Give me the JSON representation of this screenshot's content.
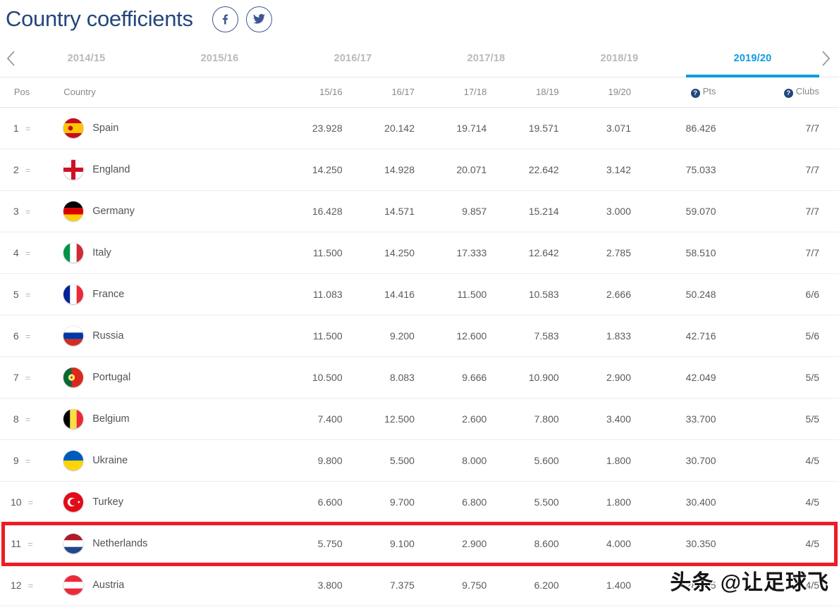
{
  "header": {
    "title": "Country coefficients",
    "social": [
      {
        "name": "facebook-share-button",
        "glyph": "f"
      },
      {
        "name": "twitter-share-button",
        "glyph": "bird"
      }
    ]
  },
  "tabs": {
    "prev_arrow": "‹",
    "next_arrow": "›",
    "items": [
      {
        "label": "2014/15",
        "active": false
      },
      {
        "label": "2015/16",
        "active": false
      },
      {
        "label": "2016/17",
        "active": false
      },
      {
        "label": "2017/18",
        "active": false
      },
      {
        "label": "2018/19",
        "active": false
      },
      {
        "label": "2019/20",
        "active": true
      }
    ],
    "active_color": "#109ae0"
  },
  "table": {
    "headers": {
      "pos": "Pos",
      "country": "Country",
      "s1516": "15/16",
      "s1617": "16/17",
      "s1718": "17/18",
      "s1819": "18/19",
      "s1920": "19/20",
      "pts": "Pts",
      "clubs": "Clubs",
      "info_glyph": "?"
    },
    "rows": [
      {
        "pos": "1",
        "move": "=",
        "flag": "spain",
        "country": "Spain",
        "s1516": "23.928",
        "s1617": "20.142",
        "s1718": "19.714",
        "s1819": "19.571",
        "s1920": "3.071",
        "pts": "86.426",
        "clubs": "7/7"
      },
      {
        "pos": "2",
        "move": "=",
        "flag": "england",
        "country": "England",
        "s1516": "14.250",
        "s1617": "14.928",
        "s1718": "20.071",
        "s1819": "22.642",
        "s1920": "3.142",
        "pts": "75.033",
        "clubs": "7/7"
      },
      {
        "pos": "3",
        "move": "=",
        "flag": "germany",
        "country": "Germany",
        "s1516": "16.428",
        "s1617": "14.571",
        "s1718": "9.857",
        "s1819": "15.214",
        "s1920": "3.000",
        "pts": "59.070",
        "clubs": "7/7"
      },
      {
        "pos": "4",
        "move": "=",
        "flag": "italy",
        "country": "Italy",
        "s1516": "11.500",
        "s1617": "14.250",
        "s1718": "17.333",
        "s1819": "12.642",
        "s1920": "2.785",
        "pts": "58.510",
        "clubs": "7/7"
      },
      {
        "pos": "5",
        "move": "=",
        "flag": "france",
        "country": "France",
        "s1516": "11.083",
        "s1617": "14.416",
        "s1718": "11.500",
        "s1819": "10.583",
        "s1920": "2.666",
        "pts": "50.248",
        "clubs": "6/6"
      },
      {
        "pos": "6",
        "move": "=",
        "flag": "russia",
        "country": "Russia",
        "s1516": "11.500",
        "s1617": "9.200",
        "s1718": "12.600",
        "s1819": "7.583",
        "s1920": "1.833",
        "pts": "42.716",
        "clubs": "5/6"
      },
      {
        "pos": "7",
        "move": "=",
        "flag": "portugal",
        "country": "Portugal",
        "s1516": "10.500",
        "s1617": "8.083",
        "s1718": "9.666",
        "s1819": "10.900",
        "s1920": "2.900",
        "pts": "42.049",
        "clubs": "5/5"
      },
      {
        "pos": "8",
        "move": "=",
        "flag": "belgium",
        "country": "Belgium",
        "s1516": "7.400",
        "s1617": "12.500",
        "s1718": "2.600",
        "s1819": "7.800",
        "s1920": "3.400",
        "pts": "33.700",
        "clubs": "5/5"
      },
      {
        "pos": "9",
        "move": "=",
        "flag": "ukraine",
        "country": "Ukraine",
        "s1516": "9.800",
        "s1617": "5.500",
        "s1718": "8.000",
        "s1819": "5.600",
        "s1920": "1.800",
        "pts": "30.700",
        "clubs": "4/5"
      },
      {
        "pos": "10",
        "move": "=",
        "flag": "turkey",
        "country": "Turkey",
        "s1516": "6.600",
        "s1617": "9.700",
        "s1718": "6.800",
        "s1819": "5.500",
        "s1920": "1.800",
        "pts": "30.400",
        "clubs": "4/5"
      },
      {
        "pos": "11",
        "move": "=",
        "flag": "netherlands",
        "country": "Netherlands",
        "s1516": "5.750",
        "s1617": "9.100",
        "s1718": "2.900",
        "s1819": "8.600",
        "s1920": "4.000",
        "pts": "30.350",
        "clubs": "4/5",
        "highlighted": true
      },
      {
        "pos": "12",
        "move": "=",
        "flag": "austria",
        "country": "Austria",
        "s1516": "3.800",
        "s1617": "7.375",
        "s1718": "9.750",
        "s1819": "6.200",
        "s1920": "1.400",
        "pts": "28.525",
        "clubs": "4/5"
      }
    ],
    "highlight_color": "#ee1c23"
  },
  "watermark": {
    "text": "头条 @让足球飞"
  }
}
